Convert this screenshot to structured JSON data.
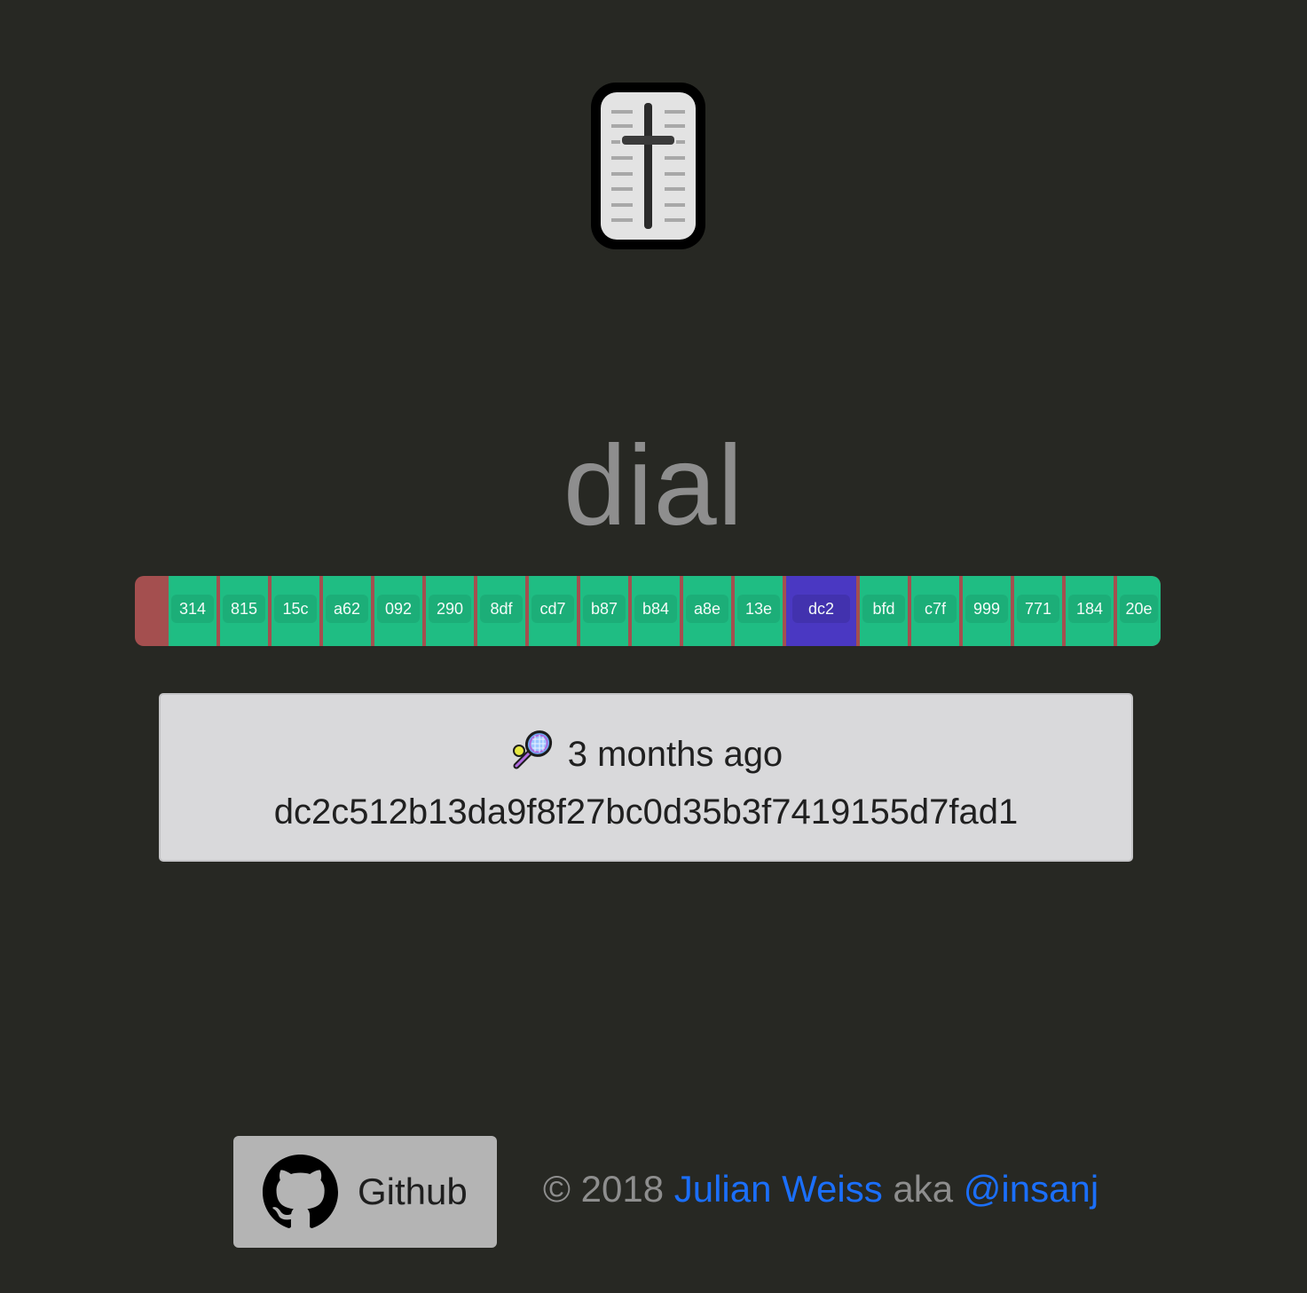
{
  "app": {
    "logo_icon": "fader-slider-icon",
    "title": "dial"
  },
  "timeline": {
    "commits": [
      {
        "label": "314",
        "active": false
      },
      {
        "label": "815",
        "active": false
      },
      {
        "label": "15c",
        "active": false
      },
      {
        "label": "a62",
        "active": false
      },
      {
        "label": "092",
        "active": false
      },
      {
        "label": "290",
        "active": false
      },
      {
        "label": "8df",
        "active": false
      },
      {
        "label": "cd7",
        "active": false
      },
      {
        "label": "b87",
        "active": false
      },
      {
        "label": "b84",
        "active": false
      },
      {
        "label": "a8e",
        "active": false
      },
      {
        "label": "13e",
        "active": false
      },
      {
        "label": "dc2",
        "active": true
      },
      {
        "label": "bfd",
        "active": false
      },
      {
        "label": "c7f",
        "active": false
      },
      {
        "label": "999",
        "active": false
      },
      {
        "label": "771",
        "active": false
      },
      {
        "label": "184",
        "active": false
      },
      {
        "label": "20e",
        "active": false
      }
    ],
    "colors": {
      "segment": "#1fbd83",
      "active_segment": "#4a38c2",
      "separator": "#a44f4f"
    }
  },
  "commit_card": {
    "icon": "tennis-racket-icon",
    "time_ago": "3 months ago",
    "hash": "dc2c512b13da9f8f27bc0d35b3f7419155d7fad1"
  },
  "footer": {
    "github_label": "Github",
    "github_icon": "github-icon",
    "copyright": "© 2018",
    "author": "Julian Weiss",
    "aka": "aka",
    "handle": "@insanj",
    "link_color": "#1b6ffb"
  }
}
